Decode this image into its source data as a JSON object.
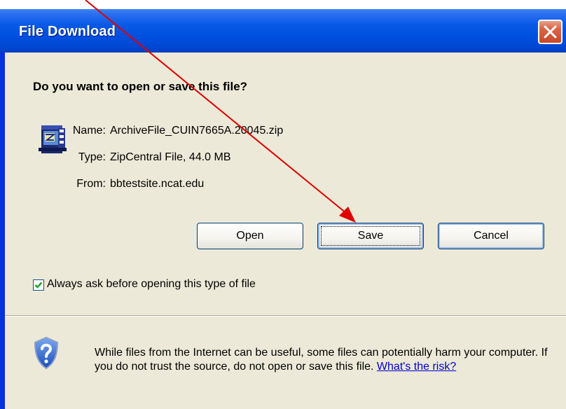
{
  "dialog": {
    "title": "File Download",
    "question": "Do you want to open or save this file?",
    "file_info": {
      "name_label": "Name:",
      "name_value": "ArchiveFile_CUIN7665A.20045.zip",
      "type_label": "Type:",
      "type_value": "ZipCentral File, 44.0 MB",
      "from_label": "From:",
      "from_value": "bbtestsite.ncat.edu"
    },
    "buttons": {
      "open": "Open",
      "save": "Save",
      "cancel": "Cancel"
    },
    "checkbox": {
      "label": "Always ask before opening this type of file",
      "checked": true
    },
    "warning": {
      "text": "While files from the Internet can be useful, some files can potentially harm your computer. If you do not trust the source, do not open or save this file.",
      "link_text": "What's the risk?"
    }
  },
  "colors": {
    "titlebar": "#0050e0",
    "client_bg": "#ece9d8",
    "close_button": "#d9664a",
    "annotation_arrow": "#e00000",
    "link": "#0000cc"
  },
  "icons": {
    "file": "zip-file-icon",
    "close": "close-icon",
    "check": "check-icon",
    "security": "shield-question-icon"
  }
}
